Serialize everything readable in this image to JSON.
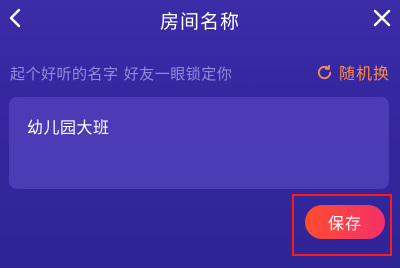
{
  "header": {
    "title": "房间名称",
    "back_icon": "chevron-left-icon",
    "close_icon": "close-icon"
  },
  "hint": {
    "text": "起个好听的名字 好友一眼锁定你"
  },
  "randomize": {
    "label": "随机换",
    "icon": "refresh-icon",
    "color": "#ff8a4d"
  },
  "name_input": {
    "value": "幼儿园大班"
  },
  "save": {
    "label": "保存",
    "highlight_color": "#ff1a1a"
  },
  "colors": {
    "background": "#3427a0",
    "accent_gradient_start": "#ff4d2e",
    "accent_gradient_end": "#f5306a"
  }
}
